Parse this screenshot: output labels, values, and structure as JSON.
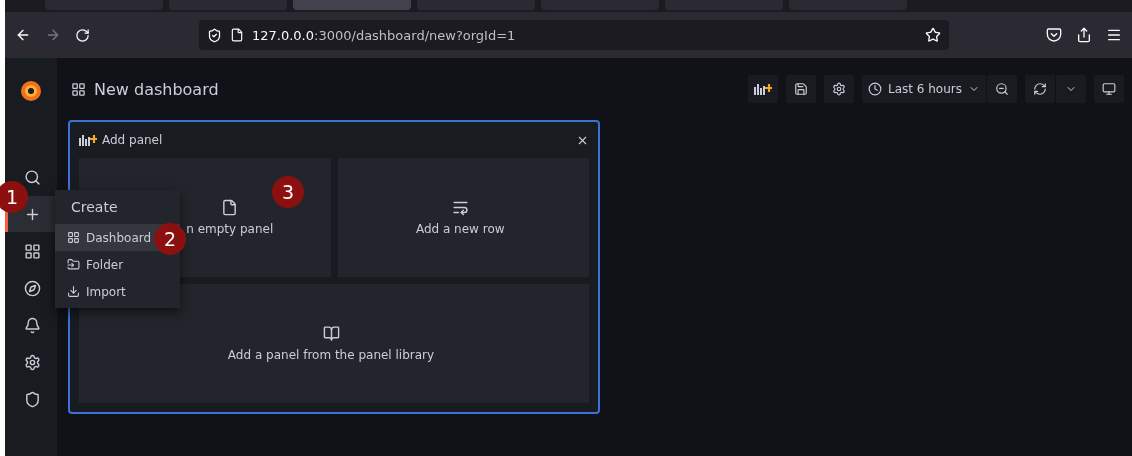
{
  "browser": {
    "tabs": [
      {
        "selected": false
      },
      {
        "selected": false
      },
      {
        "selected": true
      },
      {
        "selected": false
      },
      {
        "selected": false
      },
      {
        "selected": false
      },
      {
        "selected": false
      }
    ],
    "url": "**127.0.0.0**:3000/dashboard/new?orgId=1"
  },
  "sidebar": {
    "items": [
      {
        "selected": false
      },
      {
        "selected": true
      },
      {
        "selected": false
      },
      {
        "selected": false
      },
      {
        "selected": false
      },
      {
        "selected": false
      },
      {
        "selected": false
      }
    ]
  },
  "page_title": "New dashboard",
  "toolbar": {
    "time_range": "Last 6 hours"
  },
  "add_panel": {
    "title": "Add panel",
    "options": [
      {
        "kind": "empty",
        "label": "n empty panel"
      },
      {
        "kind": "row",
        "label": "Add a new row"
      },
      {
        "kind": "library",
        "label": "Add a panel from the panel library"
      }
    ]
  },
  "create_menu": {
    "title": "Create",
    "items": [
      {
        "kind": "dashboard",
        "label": "Dashboard",
        "selected": true
      },
      {
        "kind": "folder",
        "label": "Folder",
        "selected": false
      },
      {
        "kind": "import",
        "label": "Import",
        "selected": false
      }
    ]
  },
  "annotations": [
    {
      "label": "1"
    },
    {
      "label": "2"
    },
    {
      "label": "3"
    }
  ]
}
